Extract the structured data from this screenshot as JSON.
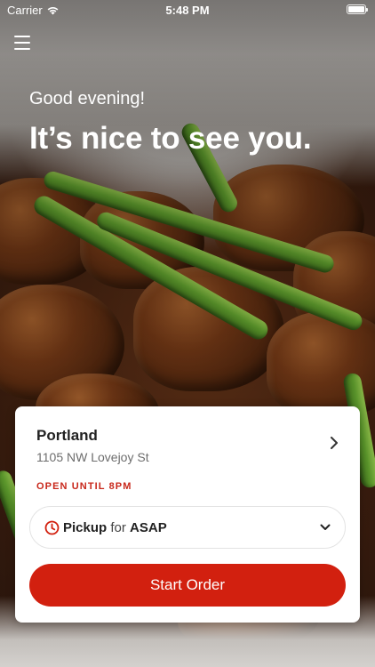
{
  "status_bar": {
    "carrier": "Carrier",
    "time": "5:48 PM"
  },
  "hero": {
    "greeting": "Good evening!",
    "headline": "It’s nice to see you."
  },
  "location": {
    "name": "Portland",
    "address": "1105 NW Lovejoy St",
    "status": "OPEN UNTIL 8PM"
  },
  "order": {
    "mode": "Pickup",
    "connector": "for",
    "time": "ASAP",
    "start_label": "Start Order"
  },
  "colors": {
    "accent": "#d2200f",
    "status_text": "#c8281b"
  },
  "icons": {
    "menu": "menu-icon",
    "wifi": "wifi-icon",
    "battery": "battery-icon",
    "chevron": "chevron-right-icon",
    "clock": "clock-icon",
    "dropdown": "chevron-down-icon"
  }
}
